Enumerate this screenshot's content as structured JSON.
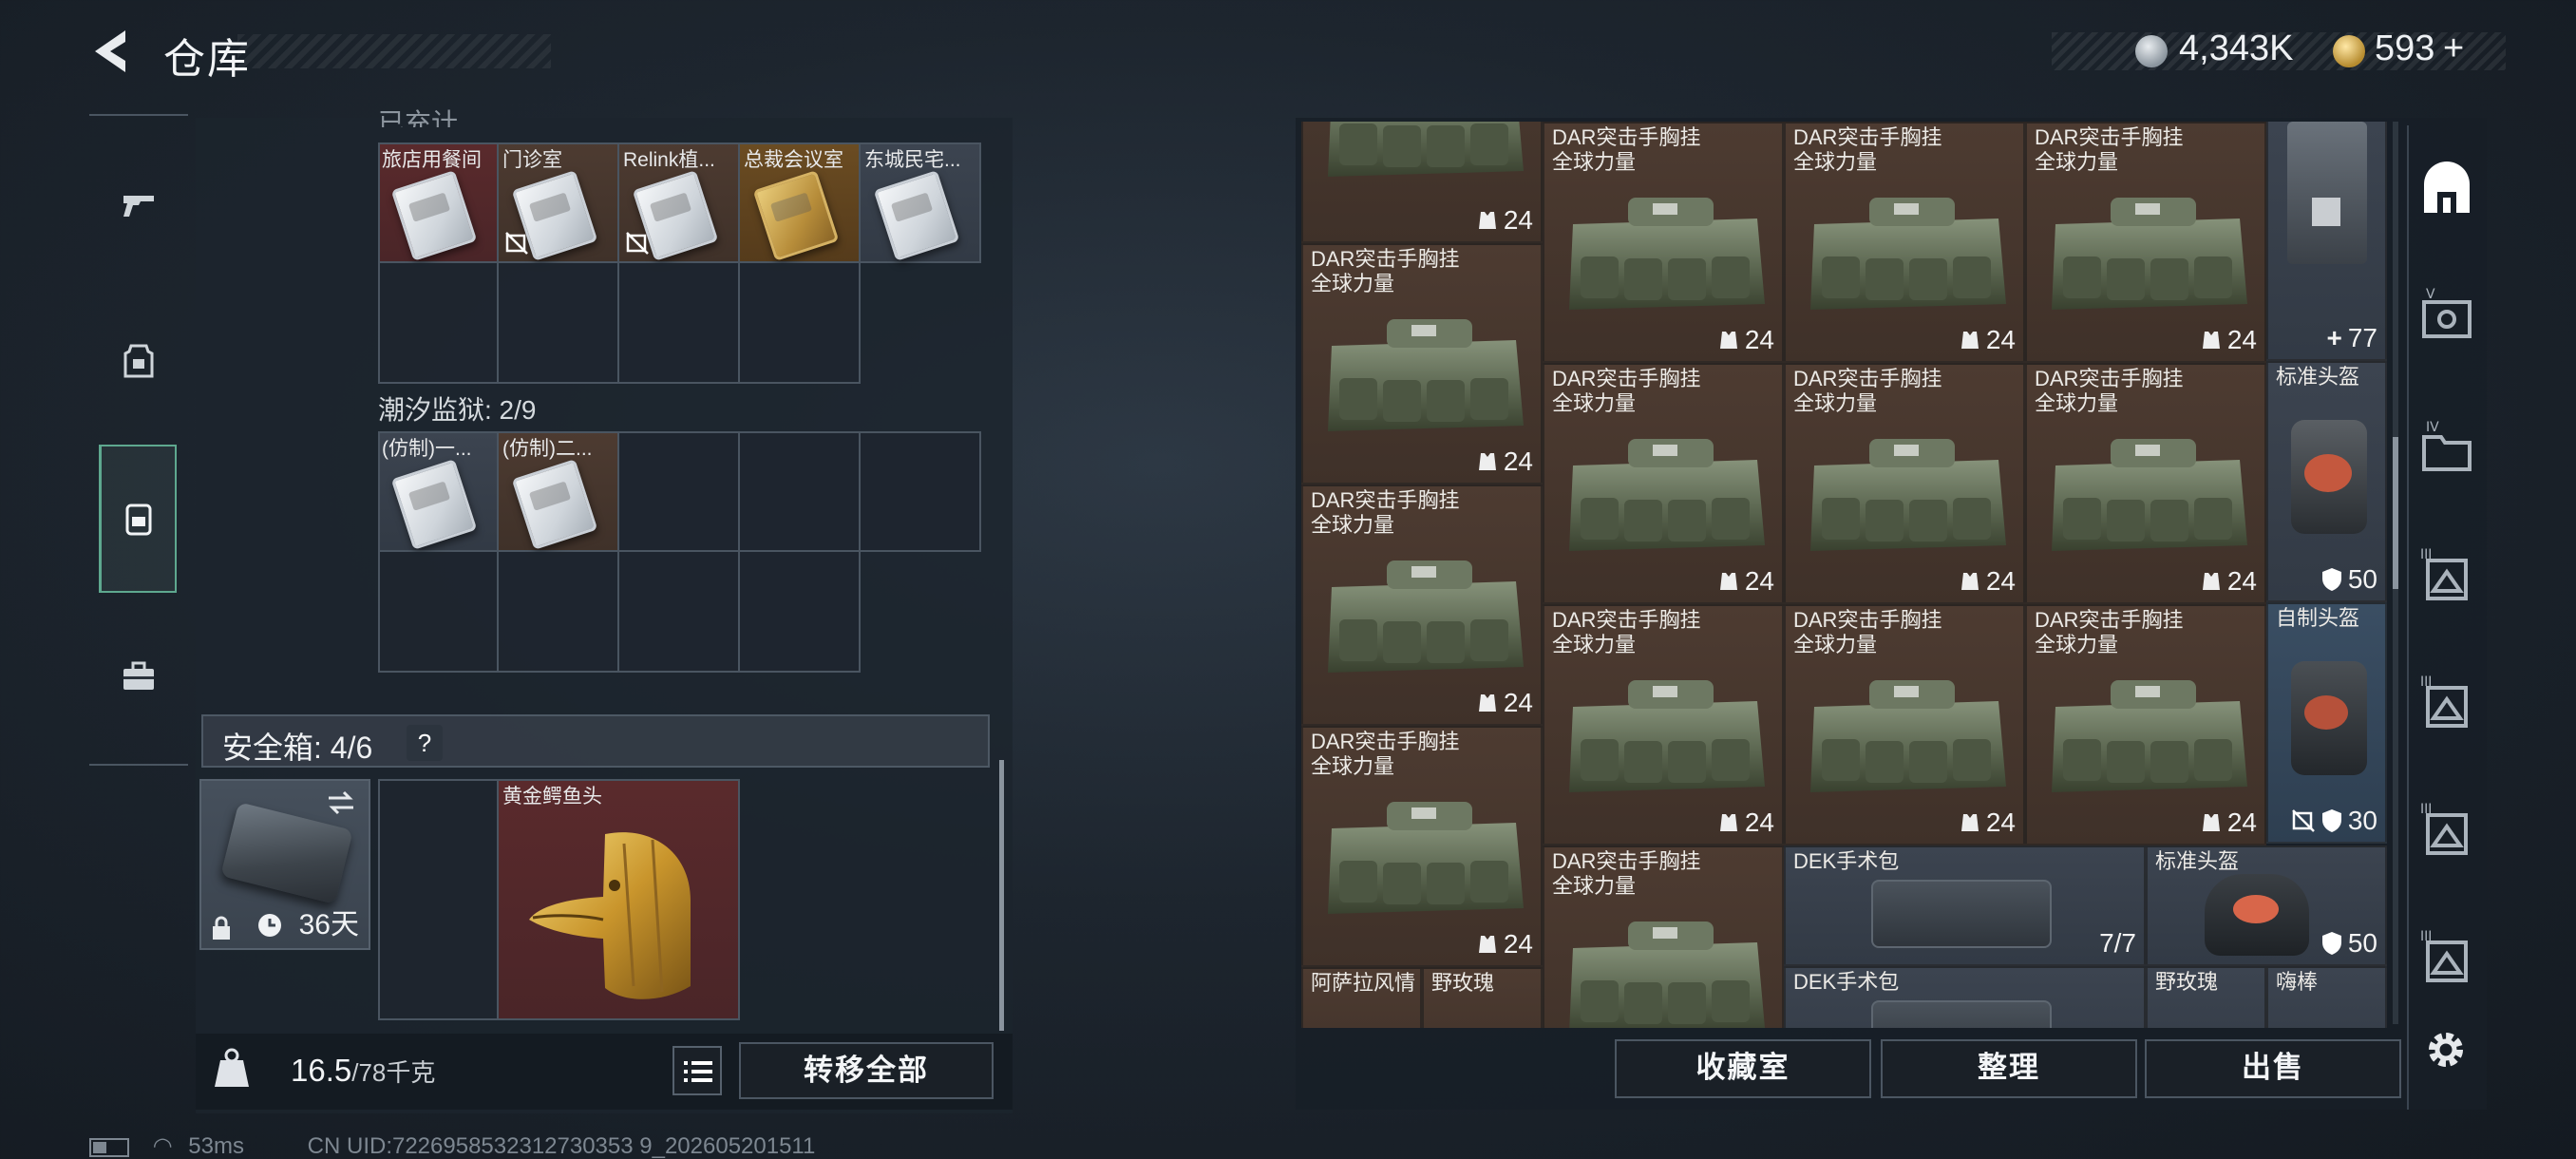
{
  "header": {
    "title": "仓库",
    "silver": "4,343K",
    "gold": "593",
    "gold_plus": "+"
  },
  "left_rail": {
    "items": [
      "weapon-tab",
      "gear-tab",
      "backpack-tab",
      "toolbox-tab"
    ]
  },
  "collection": {
    "section1_label_partial": "已充计",
    "row1": [
      {
        "name": "旅店用餐间",
        "style": "red",
        "card": "silver",
        "nobind": false
      },
      {
        "name": "门诊室",
        "style": "brown",
        "card": "silver",
        "nobind": true
      },
      {
        "name": "Relink植...",
        "style": "brown",
        "card": "silver",
        "nobind": true
      },
      {
        "name": "总裁会议室",
        "style": "gold",
        "card": "gold",
        "nobind": false
      },
      {
        "name": "东城民宅...",
        "style": "gray",
        "card": "silver",
        "nobind": false
      }
    ],
    "section2_label": "潮汐监狱: 2/9",
    "row2": [
      {
        "name": "(仿制)一...",
        "style": "gray",
        "card": "silver"
      },
      {
        "name": "(仿制)二...",
        "style": "brown",
        "card": "silver"
      }
    ]
  },
  "safebox": {
    "label": "安全箱: 4/6",
    "help": "?",
    "days": "36天",
    "item_name": "黄金鳄鱼头"
  },
  "footer_left": {
    "weight": "16.5",
    "weight_max": "/78千克",
    "transfer_all": "转移全部"
  },
  "right_items": {
    "bag_name": "DAR突击手胸挂\n全球力量",
    "bag_count": "24",
    "medkit_plus": "77",
    "helmet1": "标准头盔",
    "helmet1_count": "50",
    "helmet2": "自制头盔",
    "helmet2_count": "30",
    "surgical": "DEK手术包",
    "surgical_count": "7/7",
    "helmet3": "标准头盔",
    "helmet3_count": "50",
    "drink1": "阿萨拉风情",
    "drink2": "野玫瑰",
    "drink3": "野玫瑰",
    "drink4": "嗨棒",
    "surgical2": "DEK手术包"
  },
  "footer_right": {
    "collection_room": "收藏室",
    "organize": "整理",
    "sell": "出售"
  },
  "status": {
    "ping": "53ms",
    "uid": "CN UID:7226958532312730353 9_202605201511"
  },
  "colors": {
    "accent_green": "#5ea88f",
    "item_brown": "#4d3b31",
    "item_red": "#5a2a2c",
    "item_gold": "#6b4c22"
  }
}
